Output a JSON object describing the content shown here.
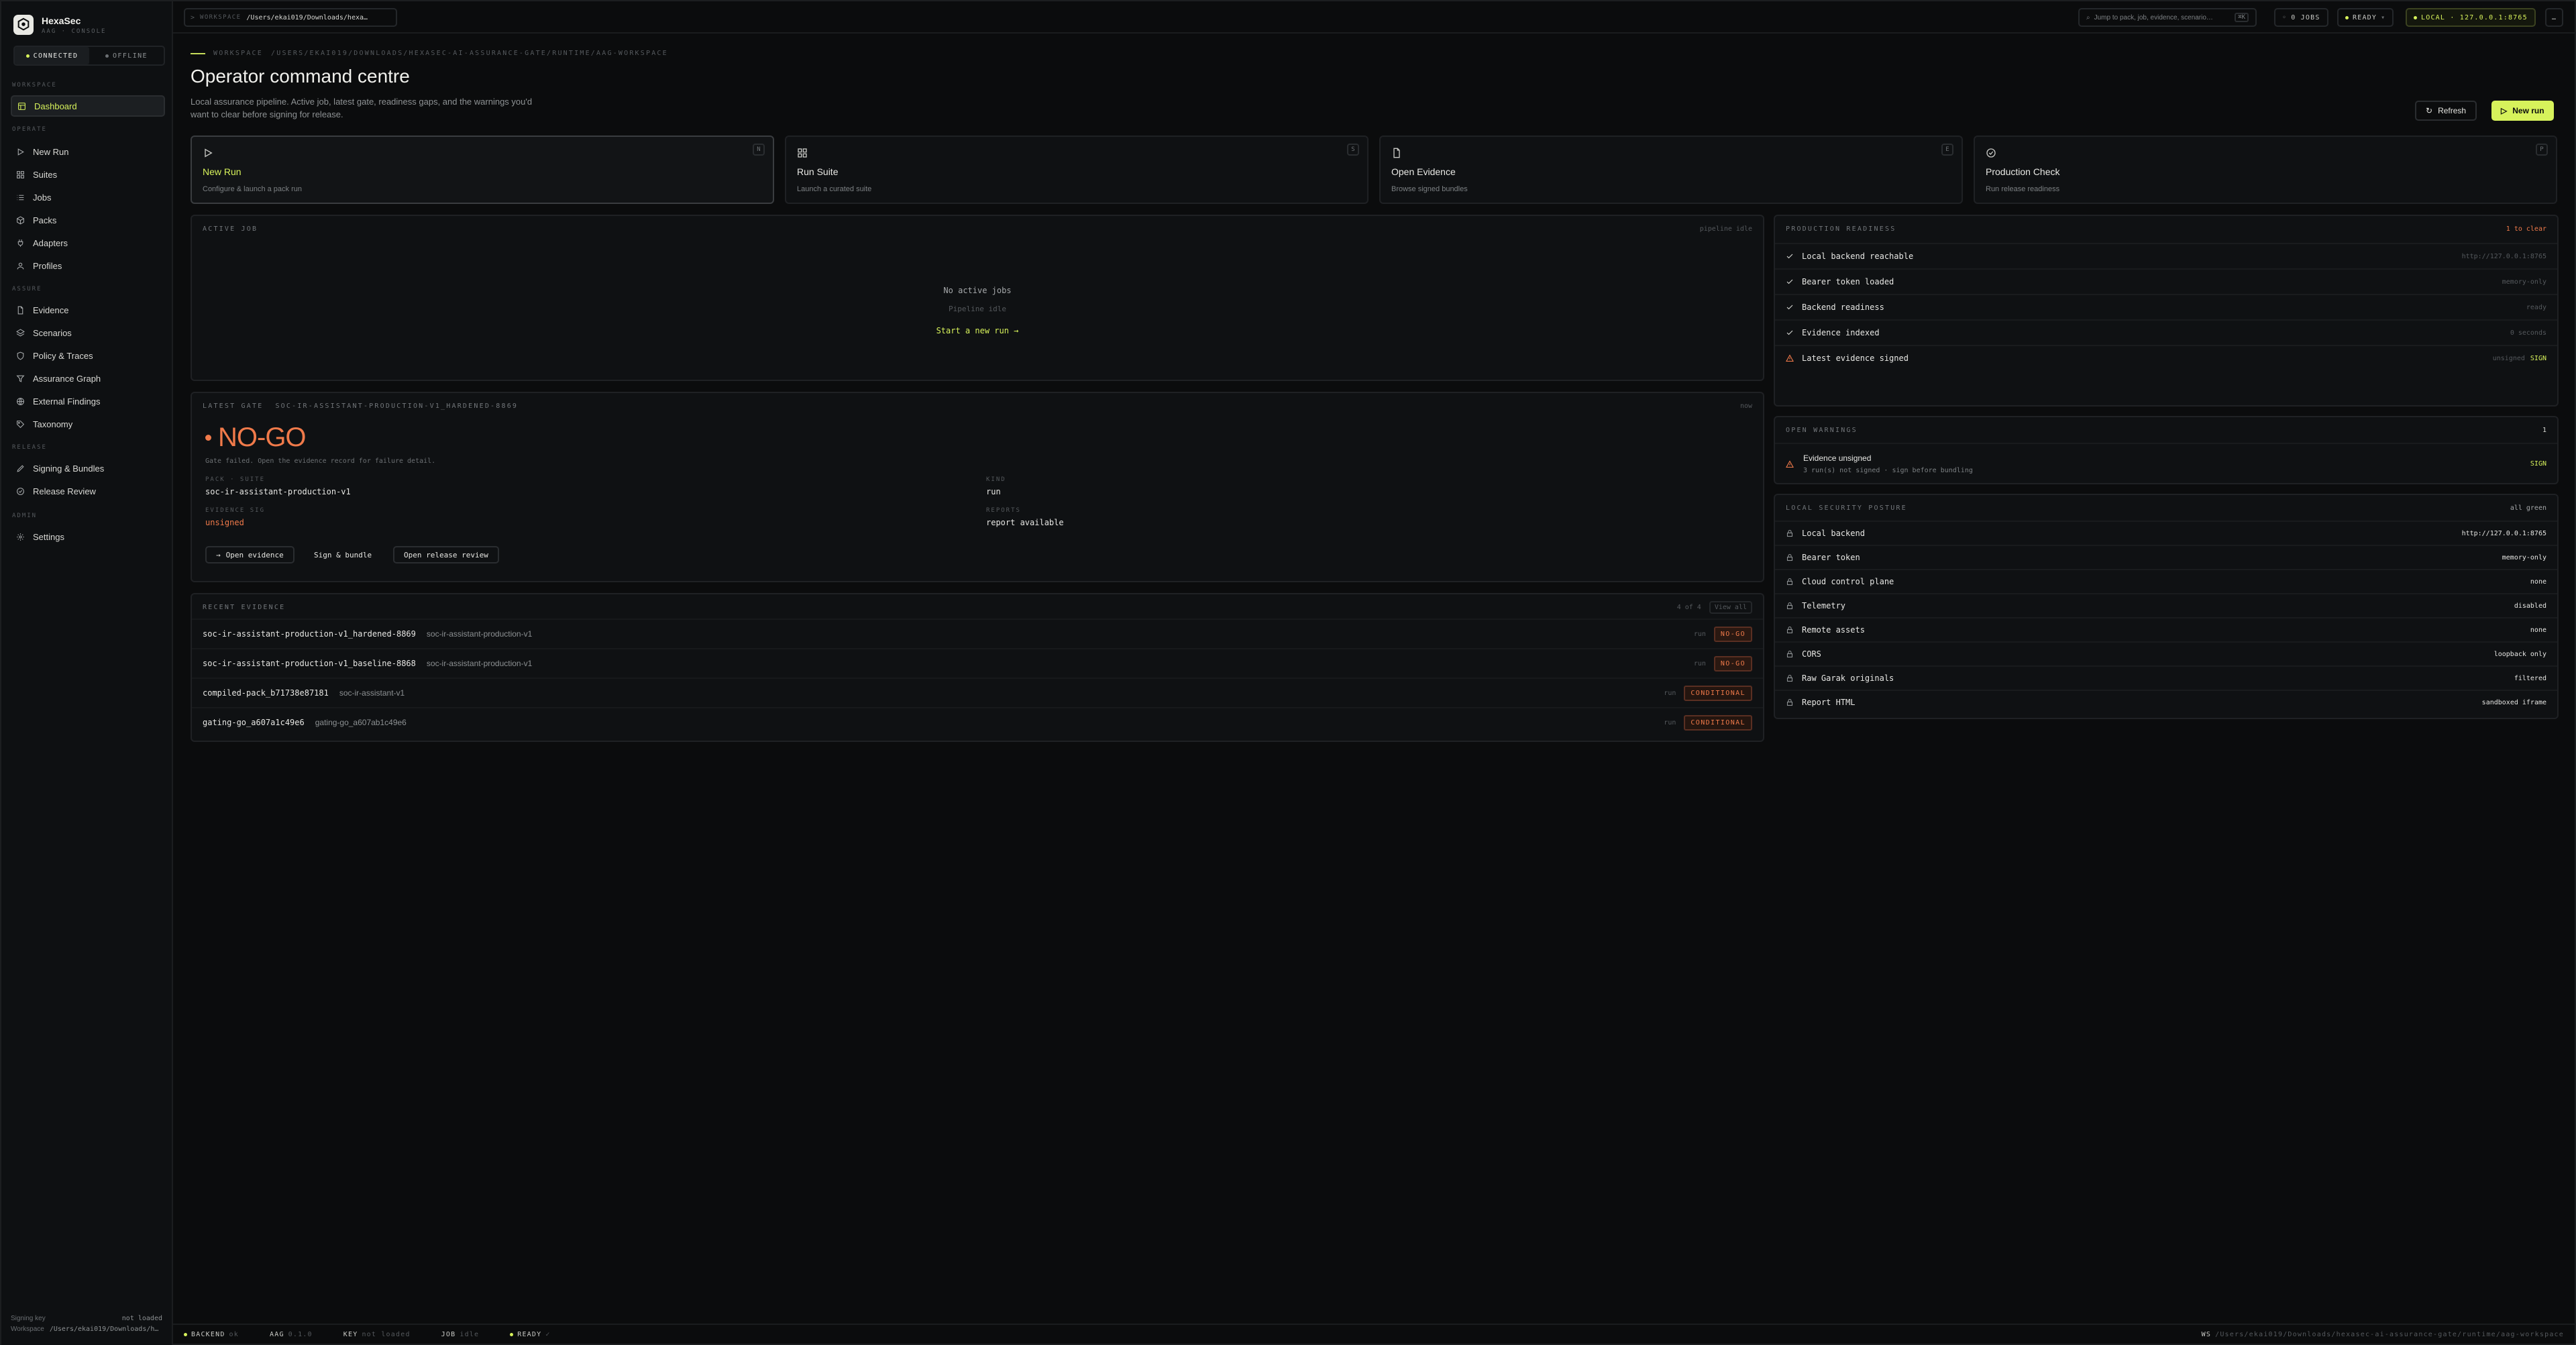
{
  "brand": {
    "title": "HexaSec",
    "subtitle": "AAG · CONSOLE"
  },
  "connection": {
    "connected": "CONNECTED",
    "offline": "OFFLINE"
  },
  "sidebar": {
    "sections": [
      {
        "title": "WORKSPACE",
        "items": [
          {
            "label": "Dashboard",
            "icon": "dashboard-icon",
            "active": true
          }
        ]
      },
      {
        "title": "OPERATE",
        "items": [
          {
            "label": "New Run",
            "icon": "play-icon"
          },
          {
            "label": "Suites",
            "icon": "grid-icon"
          },
          {
            "label": "Jobs",
            "icon": "list-icon"
          },
          {
            "label": "Packs",
            "icon": "box-icon"
          },
          {
            "label": "Adapters",
            "icon": "plug-icon"
          },
          {
            "label": "Profiles",
            "icon": "user-icon"
          }
        ]
      },
      {
        "title": "ASSURE",
        "items": [
          {
            "label": "Evidence",
            "icon": "file-icon"
          },
          {
            "label": "Scenarios",
            "icon": "layers-icon"
          },
          {
            "label": "Policy & Traces",
            "icon": "shield-icon"
          },
          {
            "label": "Assurance Graph",
            "icon": "filter-icon"
          },
          {
            "label": "External Findings",
            "icon": "globe-icon"
          },
          {
            "label": "Taxonomy",
            "icon": "tag-icon"
          }
        ]
      },
      {
        "title": "RELEASE",
        "items": [
          {
            "label": "Signing & Bundles",
            "icon": "pen-icon"
          },
          {
            "label": "Release Review",
            "icon": "check-circle-icon"
          }
        ]
      },
      {
        "title": "ADMIN",
        "items": [
          {
            "label": "Settings",
            "icon": "gear-icon"
          }
        ]
      }
    ],
    "footer": {
      "signing_key_label": "Signing key",
      "signing_key_value": "not loaded",
      "workspace_label": "Workspace",
      "workspace_value": "/Users/ekai019/Downloads/h…"
    }
  },
  "topbar": {
    "workspace_label": "WORKSPACE",
    "workspace_path": "/Users/ekai019/Downloads/hexa…",
    "search_placeholder": "Jump to pack, job, evidence, scenario…",
    "search_shortcut": "⌘K",
    "jobs": "0 JOBS",
    "ready": "READY",
    "local": "LOCAL · 127.0.0.1:8765",
    "more": "…"
  },
  "header": {
    "crumb_label": "WORKSPACE",
    "crumb_path": "/USERS/EKAI019/DOWNLOADS/HEXASEC-AI-ASSURANCE-GATE/RUNTIME/AAG-WORKSPACE",
    "title": "Operator command centre",
    "description": "Local assurance pipeline. Active job, latest gate, readiness gaps, and the warnings you'd want to clear before signing for release.",
    "refresh": "Refresh",
    "new_run": "New run"
  },
  "quick_actions": [
    {
      "title": "New Run",
      "subtitle": "Configure & launch a pack run",
      "key": "N",
      "icon": "play-icon",
      "selected": true
    },
    {
      "title": "Run Suite",
      "subtitle": "Launch a curated suite",
      "key": "S",
      "icon": "grid-icon"
    },
    {
      "title": "Open Evidence",
      "subtitle": "Browse signed bundles",
      "key": "E",
      "icon": "file-icon"
    },
    {
      "title": "Production Check",
      "subtitle": "Run release readiness",
      "key": "P",
      "icon": "check-circle-icon"
    }
  ],
  "active_job": {
    "title": "ACTIVE JOB",
    "status": "pipeline idle",
    "empty_title": "No active jobs",
    "empty_sub": "Pipeline idle",
    "link": "Start a new run →"
  },
  "latest_gate": {
    "title": "LATEST GATE",
    "run_id": "SOC-IR-ASSISTANT-PRODUCTION-V1_HARDENED-8869",
    "age": "now",
    "verdict": "NO-GO",
    "reason": "Gate failed. Open the evidence record for failure detail.",
    "pack_label": "PACK · SUITE",
    "pack_value": "soc-ir-assistant-production-v1",
    "kind_label": "KIND",
    "kind_value": "run",
    "evidence_label": "EVIDENCE SIG",
    "evidence_value": "unsigned",
    "reports_label": "REPORTS",
    "reports_value": "report available",
    "open_evidence": "Open evidence",
    "sign_bundle": "Sign & bundle",
    "open_release": "Open release review"
  },
  "recent_evidence": {
    "title": "RECENT EVIDENCE",
    "count": "4 of 4",
    "view_all": "View all",
    "rows": [
      {
        "id": "soc-ir-assistant-production-v1_hardened-8869",
        "pack": "soc-ir-assistant-production-v1",
        "type": "run",
        "badge": "NO-GO"
      },
      {
        "id": "soc-ir-assistant-production-v1_baseline-8868",
        "pack": "soc-ir-assistant-production-v1",
        "type": "run",
        "badge": "NO-GO"
      },
      {
        "id": "compiled-pack_b71738e87181",
        "pack": "soc-ir-assistant-v1",
        "type": "run",
        "badge": "CONDITIONAL"
      },
      {
        "id": "gating-go_a607a1c49e6",
        "pack": "gating-go_a607ab1c49e6",
        "type": "run",
        "badge": "CONDITIONAL"
      }
    ]
  },
  "readiness": {
    "title": "PRODUCTION READINESS",
    "summary": "1 to clear",
    "rows": [
      {
        "label": "Local backend reachable",
        "value": "http://127.0.0.1:8765",
        "ok": true
      },
      {
        "label": "Bearer token loaded",
        "value": "memory-only",
        "ok": true
      },
      {
        "label": "Backend readiness",
        "value": "ready",
        "ok": true
      },
      {
        "label": "Evidence indexed",
        "value": "0 seconds",
        "ok": true
      },
      {
        "label": "Latest evidence signed",
        "value": "unsigned",
        "action": "SIGN",
        "ok": false
      }
    ]
  },
  "warnings": {
    "title": "OPEN WARNINGS",
    "count": "1",
    "item_title": "Evidence unsigned",
    "item_sub": "3 run(s) not signed · sign before bundling",
    "action": "SIGN"
  },
  "posture": {
    "title": "LOCAL SECURITY POSTURE",
    "summary": "all green",
    "rows": [
      {
        "label": "Local backend",
        "value": "http://127.0.0.1:8765"
      },
      {
        "label": "Bearer token",
        "value": "memory-only"
      },
      {
        "label": "Cloud control plane",
        "value": "none"
      },
      {
        "label": "Telemetry",
        "value": "disabled"
      },
      {
        "label": "Remote assets",
        "value": "none"
      },
      {
        "label": "CORS",
        "value": "loopback only"
      },
      {
        "label": "Raw Garak originals",
        "value": "filtered"
      },
      {
        "label": "Report HTML",
        "value": "sandboxed iframe"
      }
    ]
  },
  "statusbar": {
    "backend": "BACKEND",
    "backend_v": "ok",
    "aag": "AAG",
    "aag_v": "0.1.0",
    "key": "KEY",
    "key_v": "not loaded",
    "job": "JOB",
    "job_v": "idle",
    "ready": "READY",
    "ready_v": "✓",
    "ws_label": "WS",
    "ws_path": "/Users/ekai019/Downloads/hexasec-ai-assurance-gate/runtime/aag-workspace"
  },
  "colors": {
    "accent": "#d7f25b",
    "danger": "#f07a4a",
    "ok": "#e7e7e4"
  }
}
